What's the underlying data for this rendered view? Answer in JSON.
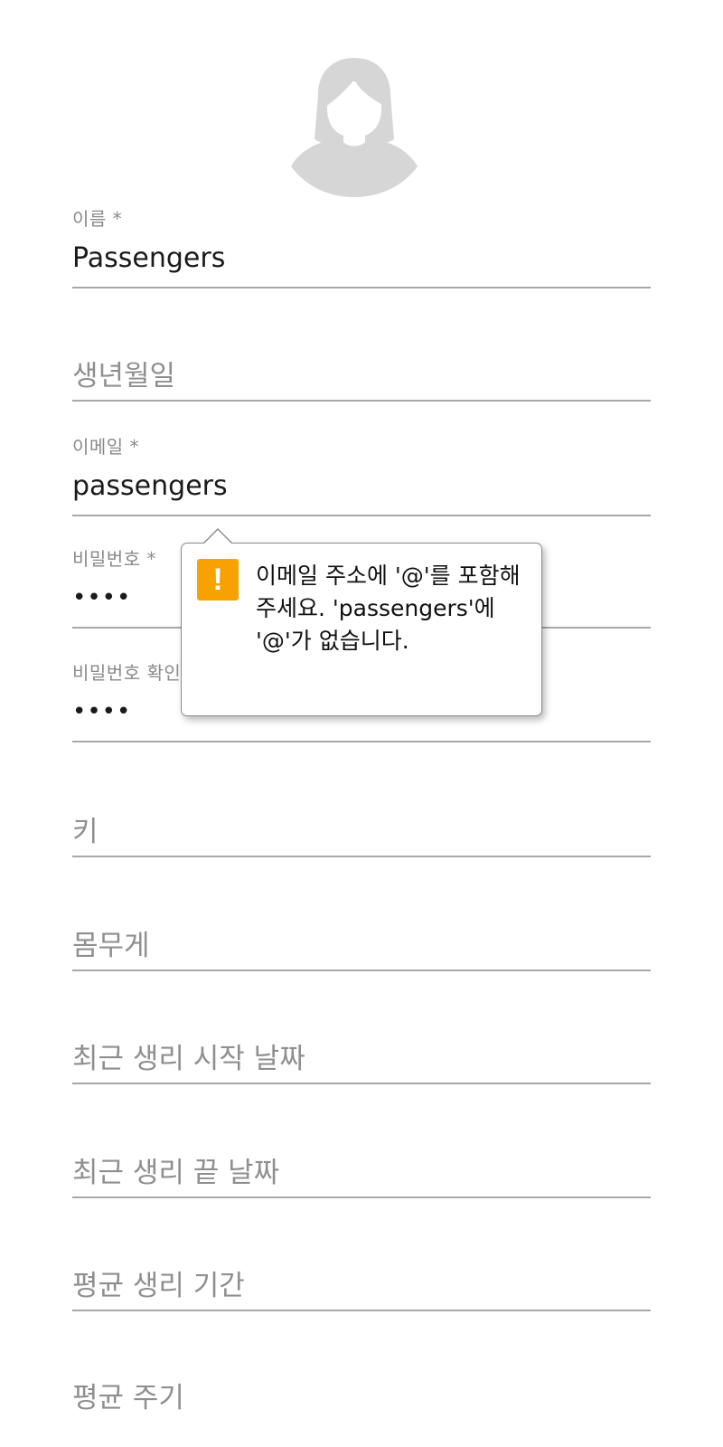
{
  "avatar": {
    "icon": "female-avatar-icon",
    "color": "#d6d6d6"
  },
  "fields": {
    "name": {
      "label": "이름 *",
      "value": "Passengers"
    },
    "birthdate": {
      "placeholder": "생년월일"
    },
    "email": {
      "label": "이메일 *",
      "value": "passengers"
    },
    "password": {
      "label": "비밀번호 *",
      "value": "••••"
    },
    "password_confirm": {
      "label": "비밀번호 확인 *",
      "value": "••••"
    },
    "height": {
      "placeholder": "키"
    },
    "weight": {
      "placeholder": "몸무게"
    },
    "period_start": {
      "placeholder": "최근 생리 시작 날짜"
    },
    "period_end": {
      "placeholder": "최근 생리 끝 날짜"
    },
    "avg_period_length": {
      "placeholder": "평균 생리 기간"
    },
    "avg_cycle": {
      "placeholder": "평균 주기"
    }
  },
  "validation_tooltip": {
    "icon": "warning-icon",
    "icon_glyph": "!",
    "accent": "#f7a200",
    "message": "이메일 주소에 '@'를 포함해 주세요. 'passengers'에 '@'가 없습니다."
  }
}
